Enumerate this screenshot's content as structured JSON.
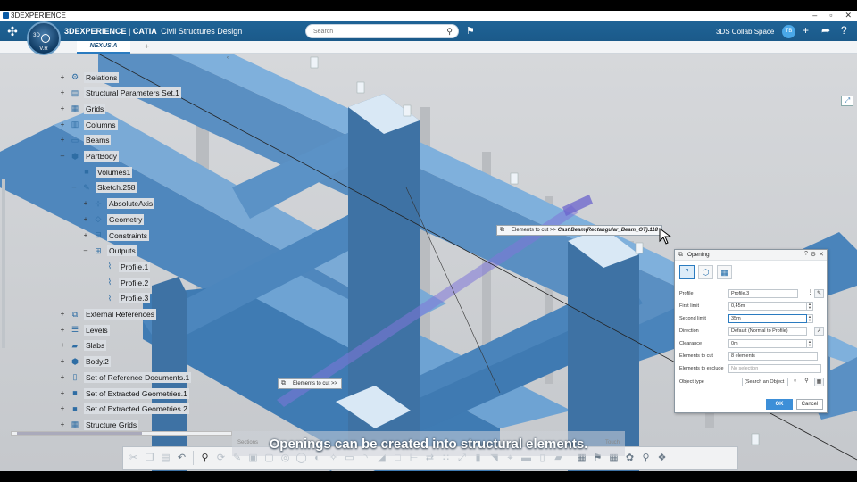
{
  "window": {
    "title": "3DEXPERIENCE",
    "controls": [
      "–",
      "▫",
      "✕"
    ]
  },
  "header": {
    "brand_bold": "3DEXPERIENCE",
    "brand_sep": " | ",
    "brand_catia": "CATIA",
    "app_name": "Civil Structures Design",
    "search_placeholder": "Search",
    "collab_space": "3DS Collab Space",
    "avatar_initials": "TB",
    "compass_top": "3D",
    "compass_bottom": "V.R",
    "accent_color": "#1f6396"
  },
  "tabs": [
    {
      "label": "NEXUS A"
    }
  ],
  "tree": {
    "items": [
      {
        "label": "Relations",
        "level": 0,
        "expander": "+",
        "icon": "relations-icon",
        "glyph": "⚙"
      },
      {
        "label": "Structural Parameters Set.1",
        "level": 0,
        "expander": "+",
        "icon": "parameters-icon",
        "glyph": "▤"
      },
      {
        "label": "Grids",
        "level": 0,
        "expander": "+",
        "icon": "grid-icon",
        "glyph": "▦"
      },
      {
        "label": "Columns",
        "level": 0,
        "expander": "+",
        "icon": "column-icon",
        "glyph": "▥"
      },
      {
        "label": "Beams",
        "level": 0,
        "expander": "+",
        "icon": "beam-icon",
        "glyph": "▭"
      },
      {
        "label": "PartBody",
        "level": 0,
        "expander": "–",
        "icon": "partbody-icon",
        "glyph": "⬢"
      },
      {
        "label": "Volumes1",
        "level": 1,
        "expander": "",
        "icon": "volume-icon",
        "glyph": "■"
      },
      {
        "label": "Sketch.258",
        "level": 1,
        "expander": "–",
        "icon": "sketch-icon",
        "glyph": "✎"
      },
      {
        "label": "AbsoluteAxis",
        "level": 2,
        "expander": "+",
        "icon": "axis-icon",
        "glyph": "⊹"
      },
      {
        "label": "Geometry",
        "level": 2,
        "expander": "+",
        "icon": "geometry-icon",
        "glyph": "◇"
      },
      {
        "label": "Constraints",
        "level": 2,
        "expander": "+",
        "icon": "constraints-icon",
        "glyph": "⊟"
      },
      {
        "label": "Outputs",
        "level": 2,
        "expander": "–",
        "icon": "outputs-icon",
        "glyph": "⊞"
      },
      {
        "label": "Profile.1",
        "level": 3,
        "expander": "",
        "icon": "profile-icon",
        "glyph": "⌇"
      },
      {
        "label": "Profile.2",
        "level": 3,
        "expander": "",
        "icon": "profile-icon",
        "glyph": "⌇"
      },
      {
        "label": "Profile.3",
        "level": 3,
        "expander": "",
        "icon": "profile-icon",
        "glyph": "⌇"
      },
      {
        "label": "External References",
        "level": 0,
        "expander": "+",
        "icon": "external-references-icon",
        "glyph": "⧉"
      },
      {
        "label": "Levels",
        "level": 0,
        "expander": "+",
        "icon": "levels-icon",
        "glyph": "☰"
      },
      {
        "label": "Slabs",
        "level": 0,
        "expander": "+",
        "icon": "slab-icon",
        "glyph": "▰"
      },
      {
        "label": "Body.2",
        "level": 0,
        "expander": "+",
        "icon": "body-icon",
        "glyph": "⬢"
      },
      {
        "label": "Set of Reference Documents.1",
        "level": 0,
        "expander": "+",
        "icon": "documents-icon",
        "glyph": "▯"
      },
      {
        "label": "Set of Extracted Geometries.1",
        "level": 0,
        "expander": "+",
        "icon": "extracted-geometry-icon",
        "glyph": "■"
      },
      {
        "label": "Set of Extracted Geometries.2",
        "level": 0,
        "expander": "+",
        "icon": "extracted-geometry-icon",
        "glyph": "■"
      },
      {
        "label": "Structure Grids",
        "level": 0,
        "expander": "+",
        "icon": "structure-grid-icon",
        "glyph": "▦"
      }
    ]
  },
  "hints": {
    "cut_prefix": "Elements to cut >> ",
    "cut_target": "Cast Beam(Rectangular_Beam_OT).118",
    "cut_simple": "Elements to cut >>"
  },
  "dialog": {
    "title": "Opening",
    "title_controls": [
      "?",
      "⚙",
      "✕"
    ],
    "profile": {
      "label": "Profile",
      "value": "Profile.3"
    },
    "first_limit": {
      "label": "First limit",
      "value": "0,45m"
    },
    "second_limit": {
      "label": "Second limit",
      "value": "35m"
    },
    "direction": {
      "label": "Direction",
      "value": "Default (Normal to Profile)"
    },
    "clearance": {
      "label": "Clearance",
      "value": "0m"
    },
    "elements_to_cut": {
      "label": "Elements to cut",
      "value": "8 elements"
    },
    "elements_to_exclude": {
      "label": "Elements to exclude",
      "placeholder": "No selection"
    },
    "object_type": {
      "label": "Object type",
      "value": "(Search an Object"
    },
    "ok_label": "OK",
    "cancel_label": "Cancel"
  },
  "caption": {
    "text": "Openings can be created into structural elements.",
    "ghost_left": "Sections",
    "ghost_right": "Touch"
  }
}
